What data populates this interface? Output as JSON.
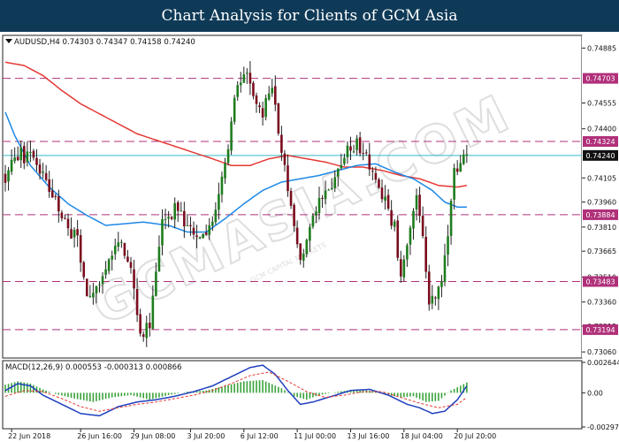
{
  "page": {
    "banner_title": "Chart Analysis for Clients of GCM Asia"
  },
  "watermark": {
    "text": "GCMASIA.COM",
    "sub": "GCM CAPITAL MARKETS"
  },
  "colors": {
    "bull": "#1e7d1e",
    "bear": "#7a0d1e",
    "wick": "#222222",
    "ma_fast": "#1e88e5",
    "ma_slow": "#e53935",
    "level": "#b0307a",
    "current": "#39b8c7",
    "macd_hist": "#3aa33a",
    "macd_signal": "#e53935",
    "macd_line": "#1f3fbf",
    "banner_bg": "#0f3a57"
  },
  "chart_data": [
    {
      "type": "candlestick",
      "symbol_header": "AUDUSD,H4  0.74303 0.74347 0.74158 0.74240",
      "symbol": "AUDUSD,H4",
      "ohlc_header": {
        "open": 0.74303,
        "high": 0.74347,
        "low": 0.74158,
        "close": 0.7424
      },
      "ylim": [
        0.7305,
        0.7494
      ],
      "y_ticks": [
        "0.74885",
        "0.74555",
        "0.74400",
        "0.74105",
        "0.73960",
        "0.73810",
        "0.73665",
        "0.73510",
        "0.73360",
        "0.73215",
        "0.73060"
      ],
      "x_ticks": [
        {
          "label": "22 Jun 2018",
          "bar": 2
        },
        {
          "label": "26 Jun 16:00",
          "bar": 24
        },
        {
          "label": "29 Jun 08:00",
          "bar": 41
        },
        {
          "label": "3 Jul 20:00",
          "bar": 59
        },
        {
          "label": "6 Jul 12:00",
          "bar": 76
        },
        {
          "label": "11 Jul 00:00",
          "bar": 93
        },
        {
          "label": "13 Jul 16:00",
          "bar": 110
        },
        {
          "label": "18 Jul 04:00",
          "bar": 127
        },
        {
          "label": "20 Jul 20:00",
          "bar": 144
        }
      ],
      "levels": [
        {
          "value": 0.74703,
          "label": "0.74703"
        },
        {
          "value": 0.74324,
          "label": "0.74324"
        },
        {
          "value": 0.73884,
          "label": "0.73884"
        },
        {
          "value": 0.73483,
          "label": "0.73483"
        },
        {
          "value": 0.73194,
          "label": "0.73194"
        }
      ],
      "current_price": {
        "value": 0.7424,
        "label": "0.74240"
      },
      "price_path": [
        [
          0,
          0.7412
        ],
        [
          4,
          0.7425
        ],
        [
          9,
          0.7422
        ],
        [
          13,
          0.7408
        ],
        [
          19,
          0.7385
        ],
        [
          23,
          0.7372
        ],
        [
          26,
          0.7335
        ],
        [
          31,
          0.7352
        ],
        [
          36,
          0.7372
        ],
        [
          40,
          0.7356
        ],
        [
          43,
          0.7318
        ],
        [
          46,
          0.7322
        ],
        [
          50,
          0.7384
        ],
        [
          54,
          0.7392
        ],
        [
          58,
          0.7382
        ],
        [
          62,
          0.7376
        ],
        [
          66,
          0.7384
        ],
        [
          70,
          0.7418
        ],
        [
          73,
          0.7455
        ],
        [
          76,
          0.7476
        ],
        [
          79,
          0.7464
        ],
        [
          82,
          0.745
        ],
        [
          85,
          0.7468
        ],
        [
          88,
          0.7425
        ],
        [
          91,
          0.7392
        ],
        [
          94,
          0.7362
        ],
        [
          97,
          0.7378
        ],
        [
          100,
          0.7402
        ],
        [
          104,
          0.7405
        ],
        [
          108,
          0.7425
        ],
        [
          112,
          0.743
        ],
        [
          116,
          0.7418
        ],
        [
          120,
          0.74
        ],
        [
          124,
          0.738
        ],
        [
          126,
          0.7352
        ],
        [
          129,
          0.7385
        ],
        [
          131,
          0.7402
        ],
        [
          133,
          0.7372
        ],
        [
          135,
          0.7338
        ],
        [
          137,
          0.734
        ],
        [
          139,
          0.7352
        ],
        [
          141,
          0.7375
        ],
        [
          143,
          0.7412
        ],
        [
          145,
          0.7422
        ],
        [
          147,
          0.7424
        ]
      ],
      "ma_fast_path": [
        [
          0,
          0.745
        ],
        [
          3,
          0.7436
        ],
        [
          8,
          0.7418
        ],
        [
          14,
          0.7405
        ],
        [
          20,
          0.7395
        ],
        [
          26,
          0.7388
        ],
        [
          32,
          0.7382
        ],
        [
          38,
          0.7383
        ],
        [
          44,
          0.7384
        ],
        [
          52,
          0.7382
        ],
        [
          58,
          0.7378
        ],
        [
          64,
          0.7378
        ],
        [
          70,
          0.7386
        ],
        [
          76,
          0.7395
        ],
        [
          82,
          0.7403
        ],
        [
          88,
          0.7408
        ],
        [
          94,
          0.741
        ],
        [
          100,
          0.7412
        ],
        [
          106,
          0.7415
        ],
        [
          112,
          0.7418
        ],
        [
          118,
          0.7419
        ],
        [
          124,
          0.7414
        ],
        [
          130,
          0.741
        ],
        [
          136,
          0.7403
        ],
        [
          140,
          0.7396
        ],
        [
          144,
          0.7393
        ],
        [
          147,
          0.7393
        ]
      ],
      "ma_slow_path": [
        [
          0,
          0.748
        ],
        [
          6,
          0.7478
        ],
        [
          12,
          0.7472
        ],
        [
          18,
          0.7463
        ],
        [
          24,
          0.7455
        ],
        [
          30,
          0.7449
        ],
        [
          36,
          0.7443
        ],
        [
          42,
          0.7437
        ],
        [
          50,
          0.7432
        ],
        [
          58,
          0.7427
        ],
        [
          66,
          0.7422
        ],
        [
          72,
          0.7418
        ],
        [
          78,
          0.7418
        ],
        [
          84,
          0.7422
        ],
        [
          90,
          0.7424
        ],
        [
          96,
          0.7422
        ],
        [
          102,
          0.742
        ],
        [
          108,
          0.7417
        ],
        [
          114,
          0.7417
        ],
        [
          120,
          0.7415
        ],
        [
          126,
          0.7412
        ],
        [
          132,
          0.741
        ],
        [
          138,
          0.7406
        ],
        [
          144,
          0.7405
        ],
        [
          147,
          0.7406
        ]
      ]
    },
    {
      "type": "histogram",
      "header": "MACD(12,26,9) 0.000553 -0.000313 0.000866",
      "params": "12,26,9",
      "values_header": {
        "macd": 0.000553,
        "signal": -0.000313,
        "third": 0.000866
      },
      "ylim": [
        -0.00297,
        0.00264
      ],
      "y_ticks": [
        "0.002644",
        "0.00",
        "-0.002970"
      ],
      "hist_path": [
        [
          0,
          0.0007
        ],
        [
          4,
          0.001
        ],
        [
          8,
          0.0008
        ],
        [
          12,
          0.0003
        ],
        [
          16,
          -0.0001
        ],
        [
          22,
          -0.0005
        ],
        [
          28,
          -0.0008
        ],
        [
          34,
          -0.0004
        ],
        [
          40,
          -0.0002
        ],
        [
          46,
          -0.0006
        ],
        [
          52,
          -0.0002
        ],
        [
          58,
          0.0001
        ],
        [
          64,
          0.0002
        ],
        [
          70,
          0.0006
        ],
        [
          76,
          0.001
        ],
        [
          82,
          0.0011
        ],
        [
          88,
          0.0004
        ],
        [
          92,
          -0.0003
        ],
        [
          96,
          -0.0006
        ],
        [
          100,
          -0.0002
        ],
        [
          106,
          0.0001
        ],
        [
          112,
          0.0003
        ],
        [
          118,
          0.0001
        ],
        [
          122,
          -0.0002
        ],
        [
          126,
          -0.0004
        ],
        [
          130,
          -0.0003
        ],
        [
          134,
          -0.0008
        ],
        [
          138,
          -0.0007
        ],
        [
          142,
          0.0002
        ],
        [
          147,
          0.0009
        ]
      ],
      "macd_path": [
        [
          0,
          0.0002
        ],
        [
          4,
          0.0008
        ],
        [
          8,
          0.0006
        ],
        [
          12,
          -0.0002
        ],
        [
          18,
          -0.001
        ],
        [
          24,
          -0.0018
        ],
        [
          30,
          -0.002
        ],
        [
          36,
          -0.0012
        ],
        [
          42,
          -0.0008
        ],
        [
          48,
          -0.0006
        ],
        [
          54,
          -0.0003
        ],
        [
          60,
          0.0001
        ],
        [
          66,
          0.0006
        ],
        [
          72,
          0.0014
        ],
        [
          78,
          0.0022
        ],
        [
          82,
          0.0024
        ],
        [
          86,
          0.0016
        ],
        [
          90,
          0.0002
        ],
        [
          94,
          -0.001
        ],
        [
          98,
          -0.0008
        ],
        [
          104,
          -0.0003
        ],
        [
          110,
          0.0002
        ],
        [
          116,
          0.0003
        ],
        [
          122,
          -0.0002
        ],
        [
          128,
          -0.001
        ],
        [
          132,
          -0.0013
        ],
        [
          136,
          -0.0018
        ],
        [
          140,
          -0.0016
        ],
        [
          144,
          -0.0006
        ],
        [
          147,
          0.0006
        ]
      ],
      "signal_path": [
        [
          0,
          -0.0003
        ],
        [
          6,
          0.0002
        ],
        [
          12,
          0.0001
        ],
        [
          18,
          -0.0005
        ],
        [
          24,
          -0.0012
        ],
        [
          30,
          -0.0016
        ],
        [
          36,
          -0.0013
        ],
        [
          42,
          -0.001
        ],
        [
          48,
          -0.0008
        ],
        [
          54,
          -0.0005
        ],
        [
          60,
          -0.0002
        ],
        [
          66,
          0.0002
        ],
        [
          72,
          0.0008
        ],
        [
          78,
          0.0015
        ],
        [
          84,
          0.0018
        ],
        [
          90,
          0.001
        ],
        [
          96,
          0.0001
        ],
        [
          102,
          -0.0004
        ],
        [
          108,
          -0.0002
        ],
        [
          114,
          0.0001
        ],
        [
          120,
          0.0001
        ],
        [
          126,
          -0.0004
        ],
        [
          132,
          -0.0009
        ],
        [
          138,
          -0.0013
        ],
        [
          144,
          -0.001
        ],
        [
          147,
          -0.0004
        ]
      ]
    }
  ]
}
